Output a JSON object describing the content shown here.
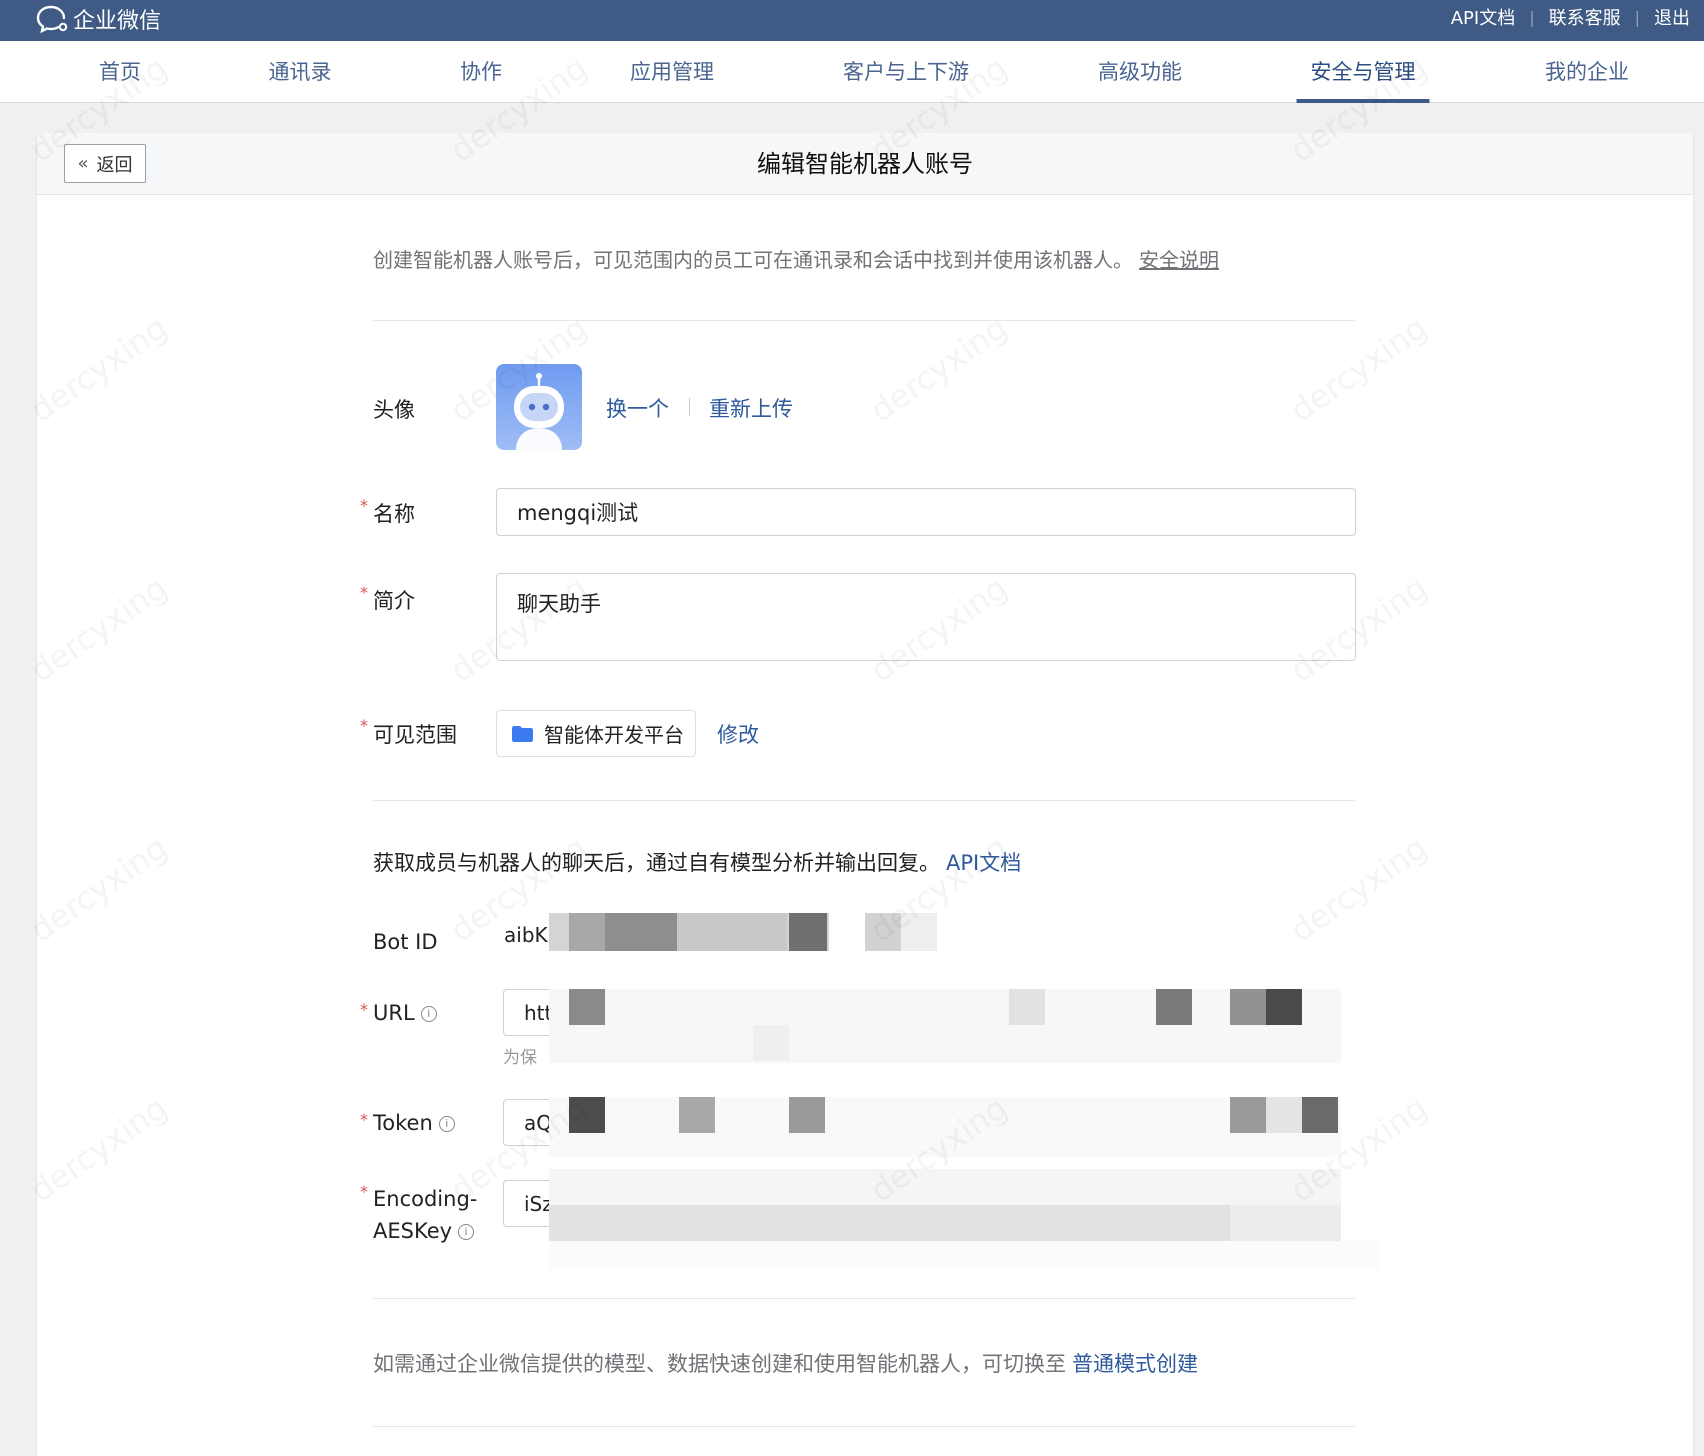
{
  "app": {
    "title": "企业微信"
  },
  "top_links": [
    "API文档",
    "联系客服",
    "退出"
  ],
  "nav": {
    "items": [
      {
        "label": "首页"
      },
      {
        "label": "通讯录"
      },
      {
        "label": "协作"
      },
      {
        "label": "应用管理"
      },
      {
        "label": "客户与上下游"
      },
      {
        "label": "高级功能"
      },
      {
        "label": "安全与管理",
        "active": true
      },
      {
        "label": "我的企业"
      }
    ]
  },
  "page": {
    "back_label": "返回",
    "title": "编辑智能机器人账号",
    "intro": "创建智能机器人账号后，可见范围内的员工可在通讯录和会话中找到并使用该机器人。",
    "security_link": "安全说明"
  },
  "form": {
    "avatar": {
      "label": "头像",
      "change": "换一个",
      "reupload": "重新上传"
    },
    "name": {
      "label": "名称",
      "value": "mengqi测试"
    },
    "intro": {
      "label": "简介",
      "value": "聊天助手"
    },
    "scope": {
      "label": "可见范围",
      "value": "智能体开发平台",
      "modify": "修改"
    }
  },
  "api": {
    "desc": "获取成员与机器人的聊天后，通过自有模型分析并输出回复。",
    "doc_link": "API文档",
    "bot_id": {
      "label": "Bot ID",
      "value": "aibK"
    },
    "url": {
      "label": "URL",
      "value": "htt",
      "hint": "为保"
    },
    "token": {
      "label": "Token",
      "value": "aQ"
    },
    "aeskey": {
      "label_line1": "Encoding-",
      "label_line2": "AESKey",
      "value": "iSz"
    }
  },
  "footer": {
    "text": "如需通过企业微信提供的模型、数据快速创建和使用智能机器人，可切换至",
    "link": "普通模式创建"
  },
  "watermark": "dercyxing",
  "colors": {
    "header_bg": "#3e5a85",
    "link": "#2f5a9c",
    "required": "#d9534f",
    "avatar": "#7fa6f2"
  }
}
